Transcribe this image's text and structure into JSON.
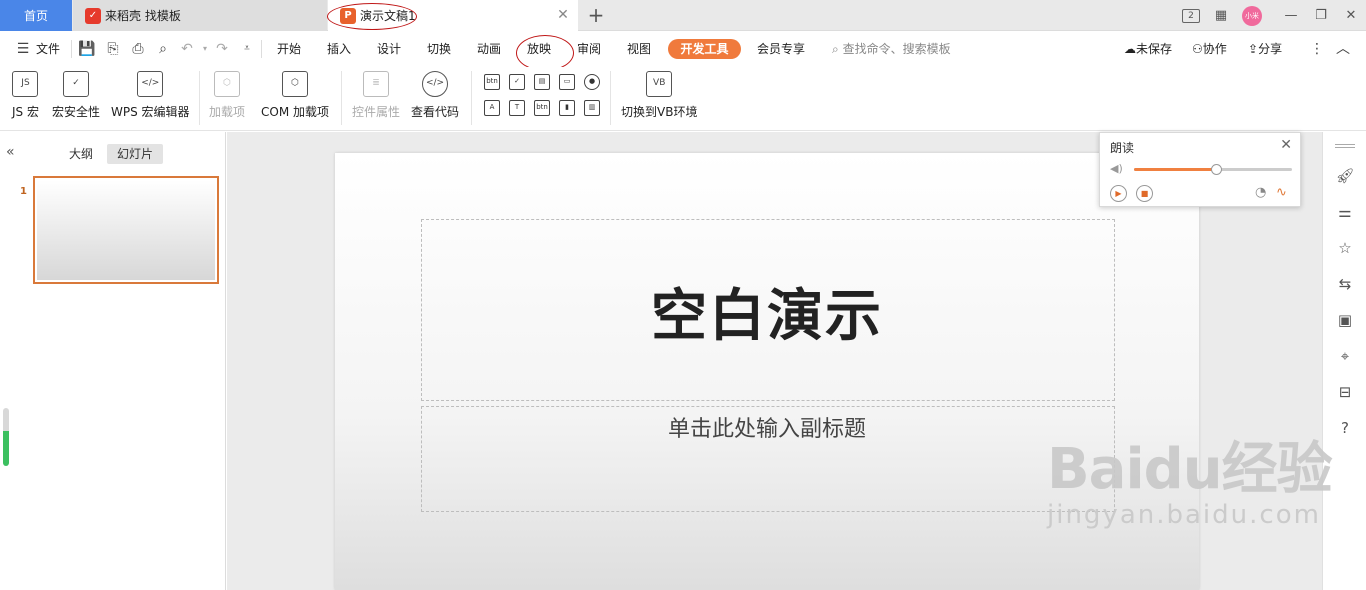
{
  "tabs": {
    "home": "首页",
    "template_tab": "来稻壳 找模板",
    "doc_tab": "演示文稿1"
  },
  "window": {
    "count_badge": "2",
    "avatar_text": "小米"
  },
  "menu": {
    "file": "文件",
    "items": [
      "开始",
      "插入",
      "设计",
      "切换",
      "动画",
      "放映",
      "审阅",
      "视图"
    ],
    "dev_tools": "开发工具",
    "member": "会员专享",
    "search_placeholder": "查找命令、搜索模板",
    "unsaved": "未保存",
    "collab": "协作",
    "share": "分享"
  },
  "ribbon": {
    "js_macro": "JS 宏",
    "macro_security": "宏安全性",
    "wps_macro_editor": "WPS 宏编辑器",
    "addins": "加载项",
    "com_addins": "COM 加载项",
    "control_props": "控件属性",
    "view_code": "查看代码",
    "switch_vb": "切换到VB环境",
    "btn_label": "btn"
  },
  "left_pane": {
    "outline_tab": "大纲",
    "slides_tab": "幻灯片",
    "slide_number": "1"
  },
  "slide": {
    "title": "空白演示",
    "subtitle": "单击此处输入副标题"
  },
  "reader": {
    "title": "朗读",
    "volume_fraction": 0.52
  },
  "watermark": {
    "main": "Baidu经验",
    "sub": "jingyan.baidu.com"
  },
  "colors": {
    "accent_orange": "#f07a3c",
    "home_tab_blue": "#4a86e8",
    "annotation_red": "#c01818"
  }
}
